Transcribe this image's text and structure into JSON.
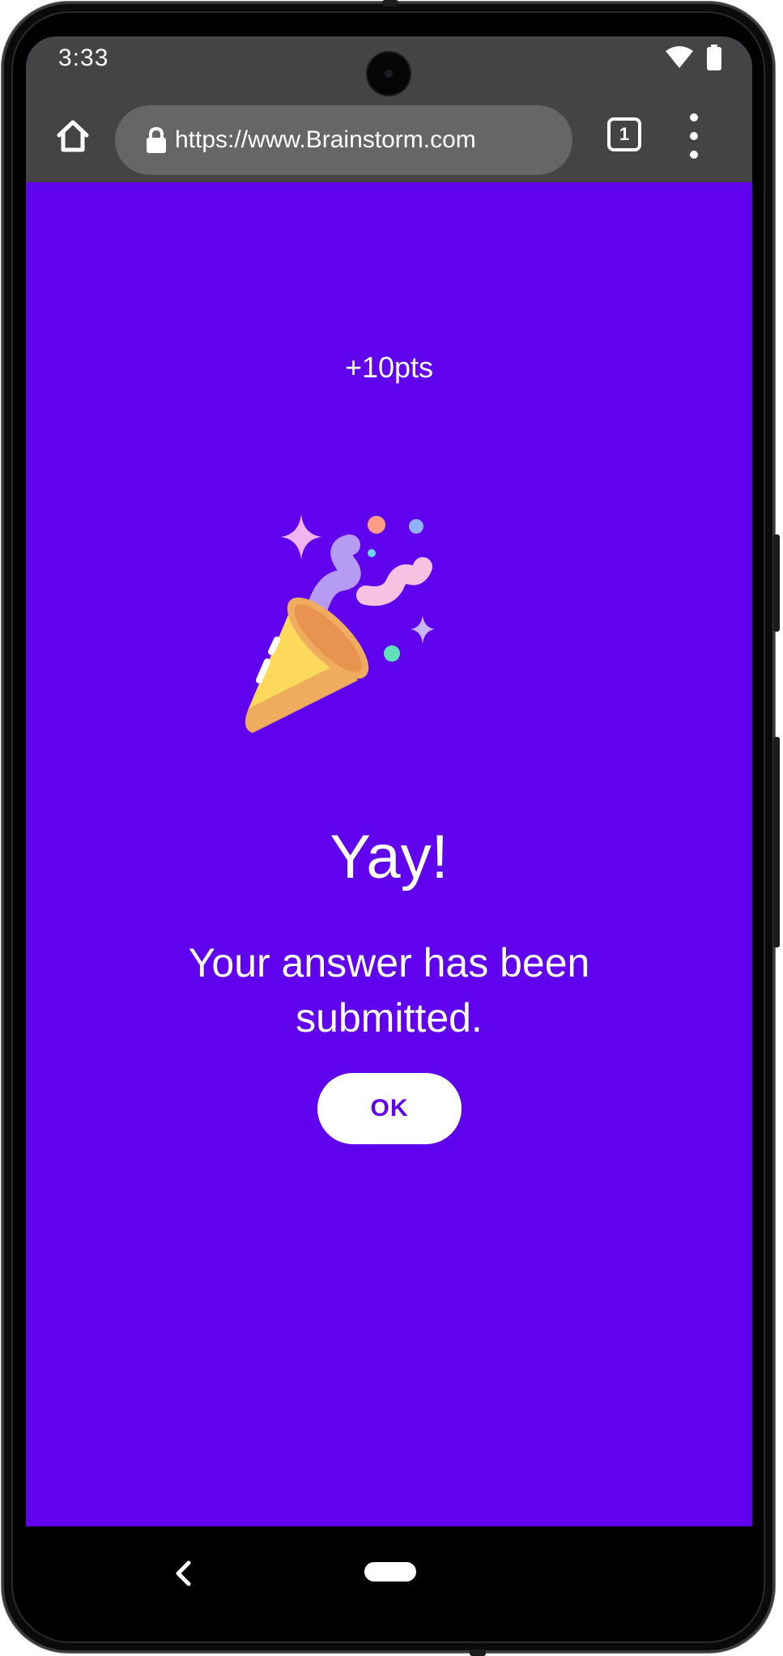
{
  "status_bar": {
    "time": "3:33",
    "icons": [
      "wifi-icon",
      "battery-icon"
    ]
  },
  "browser": {
    "url": "https://www.Brainstorm.com",
    "tab_count": "1",
    "icons": [
      "home-icon",
      "lock-icon",
      "tabs-icon",
      "more-vert-icon"
    ]
  },
  "page": {
    "points": "+10pts",
    "heading": "Yay!",
    "message": "Your answer has been submitted.",
    "ok_label": "OK",
    "illustration": "party-popper-icon"
  },
  "nav": {
    "icons": [
      "back-icon",
      "home-pill"
    ]
  },
  "colors": {
    "background": "#6002ee",
    "chrome": "#444444",
    "url_bar": "#666666",
    "button_bg": "#ffffff",
    "button_text": "#6002ee"
  }
}
